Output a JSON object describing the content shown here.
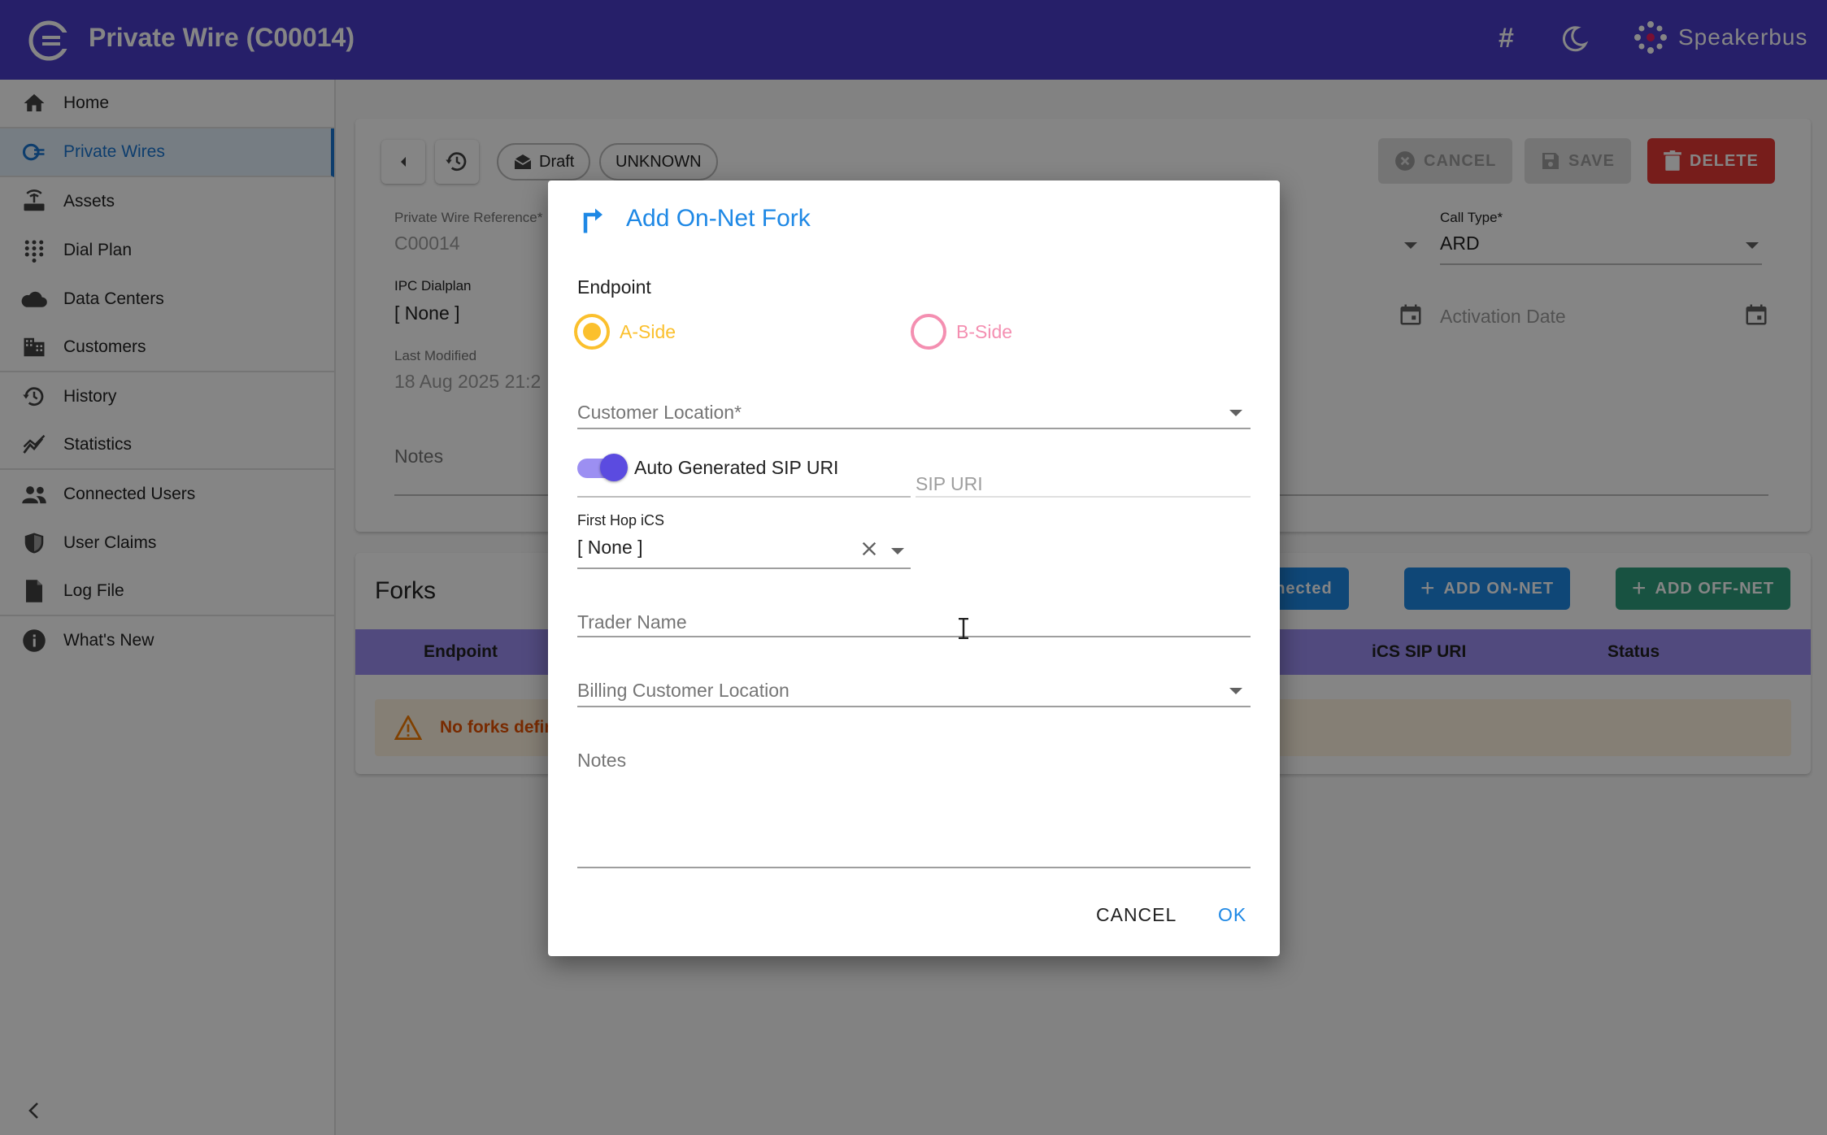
{
  "header": {
    "title": "Private Wire (C00014)",
    "hash_symbol": "#",
    "brand": "Speakerbus"
  },
  "sidebar": {
    "items": [
      {
        "label": "Home",
        "icon": "home-icon"
      },
      {
        "label": "Private Wires",
        "icon": "private-wire-icon",
        "active": true
      },
      {
        "label": "Assets",
        "icon": "router-icon"
      },
      {
        "label": "Dial Plan",
        "icon": "dialpad-icon"
      },
      {
        "label": "Data Centers",
        "icon": "cloud-icon"
      },
      {
        "label": "Customers",
        "icon": "building-icon"
      },
      {
        "label": "History",
        "icon": "history-icon"
      },
      {
        "label": "Statistics",
        "icon": "statistics-icon"
      },
      {
        "label": "Connected Users",
        "icon": "users-icon"
      },
      {
        "label": "User Claims",
        "icon": "shield-icon"
      },
      {
        "label": "Log File",
        "icon": "file-icon"
      },
      {
        "label": "What's New",
        "icon": "info-icon"
      }
    ]
  },
  "toolbar": {
    "status_chip": "Draft",
    "unknown_chip": "UNKNOWN",
    "cancel_label": "CANCEL",
    "save_label": "SAVE",
    "delete_label": "DELETE"
  },
  "form": {
    "reference_label": "Private Wire Reference*",
    "reference_value": "C00014",
    "call_type_label": "Call Type*",
    "call_type_value": "ARD",
    "ipc_label": "IPC Dialplan",
    "ipc_value": "[ None ]",
    "activation_label": "Activation Date",
    "last_modified_label": "Last Modified",
    "last_modified_value": "18 Aug 2025 21:2",
    "notes_label": "Notes"
  },
  "forks": {
    "title": "Forks",
    "connected_btn": "nnected",
    "add_on_net": "ADD ON-NET",
    "add_off_net": "ADD OFF-NET",
    "columns": {
      "endpoint": "Endpoint",
      "ics_sip_uri": "iCS SIP URI",
      "status": "Status"
    },
    "empty_message": "No forks defin"
  },
  "dialog": {
    "title": "Add On-Net Fork",
    "endpoint_label": "Endpoint",
    "a_side": "A-Side",
    "b_side": "B-Side",
    "customer_location_label": "Customer Location*",
    "auto_sip_label": "Auto Generated SIP URI",
    "sip_uri_placeholder": "SIP URI",
    "first_hop_label": "First Hop iCS",
    "first_hop_value": "[ None ]",
    "trader_name_label": "Trader Name",
    "billing_location_label": "Billing Customer Location",
    "notes_label": "Notes",
    "cancel_label": "CANCEL",
    "ok_label": "OK"
  },
  "colors": {
    "topbar": "#4a3dc9",
    "accent_blue": "#1976d2",
    "a_side": "#fbc02d",
    "b_side": "#f48fb1",
    "delete_red": "#e53935",
    "add_off_net_green": "#2e9e7e"
  }
}
